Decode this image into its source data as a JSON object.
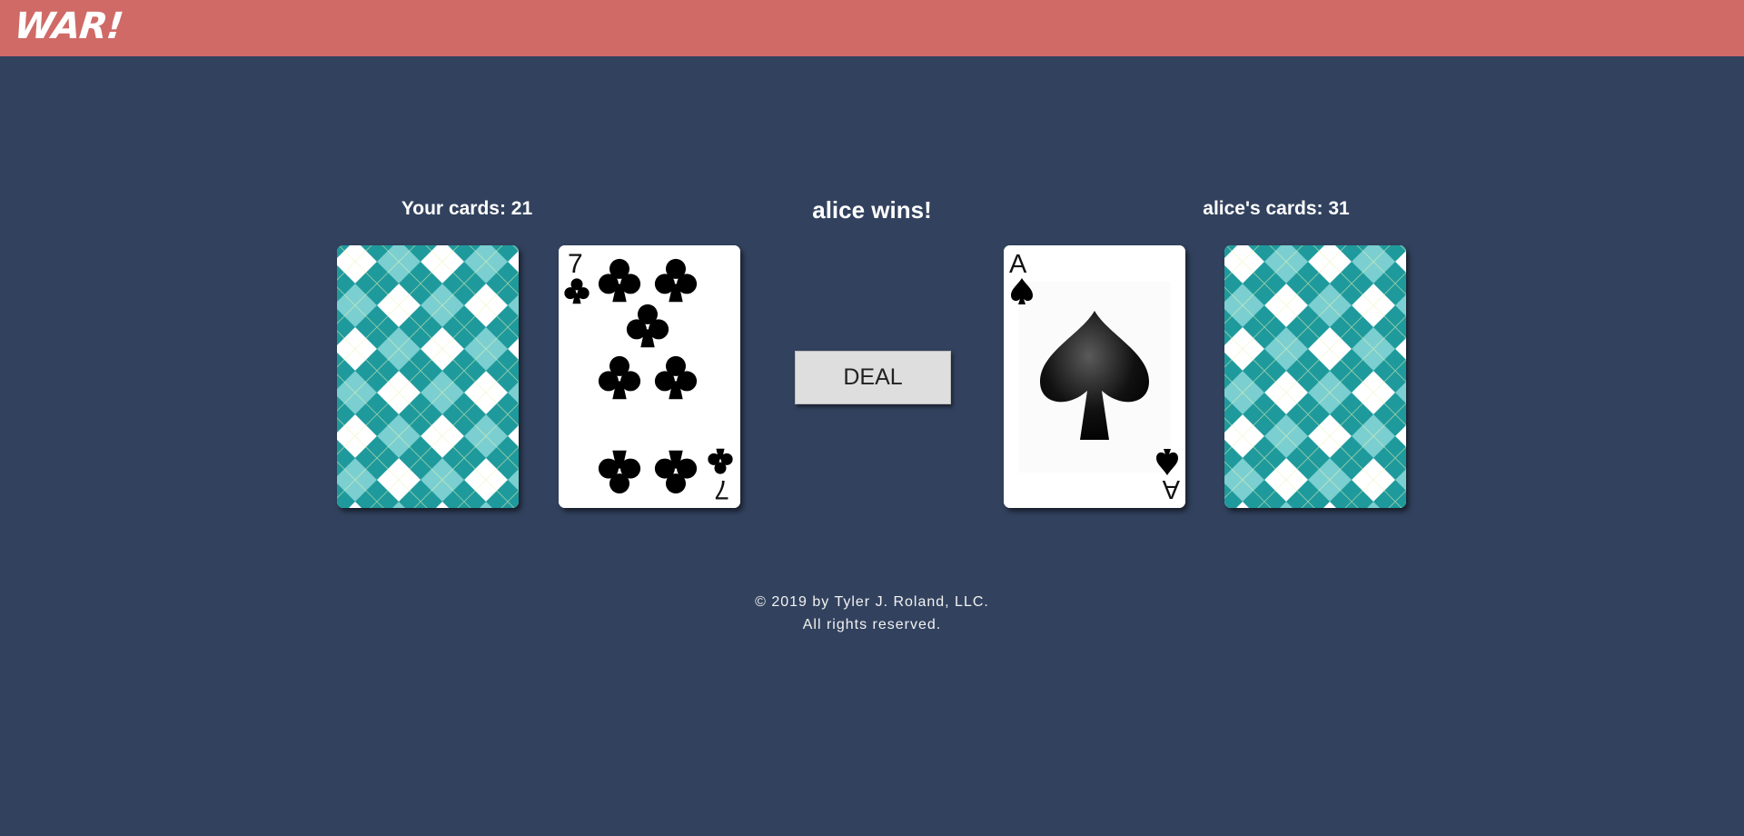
{
  "header": {
    "logo": "WAR!",
    "background_color": "#d06a67"
  },
  "game": {
    "player_count": "Your cards: 21",
    "status": "alice wins!",
    "opponent_count": "alice's cards: 31",
    "deal_label": "DEAL"
  },
  "cards": {
    "player_deck": {
      "face": "back",
      "pattern": "argyle",
      "colors": [
        "#1f9a9c",
        "#7bcfd0",
        "#ffffff"
      ]
    },
    "player_played": {
      "face": "up",
      "rank": "7",
      "suit": "clubs",
      "suit_symbol": "♣"
    },
    "opponent_played": {
      "face": "up",
      "rank": "A",
      "suit": "spades",
      "suit_symbol": "♠"
    },
    "opponent_deck": {
      "face": "back",
      "pattern": "argyle",
      "colors": [
        "#1f9a9c",
        "#7bcfd0",
        "#ffffff"
      ]
    }
  },
  "footer": {
    "line1": "© 2019 by Tyler J. Roland, LLC.",
    "line2": "All rights reserved."
  },
  "colors": {
    "background": "#32425e",
    "button": "#dedede"
  }
}
